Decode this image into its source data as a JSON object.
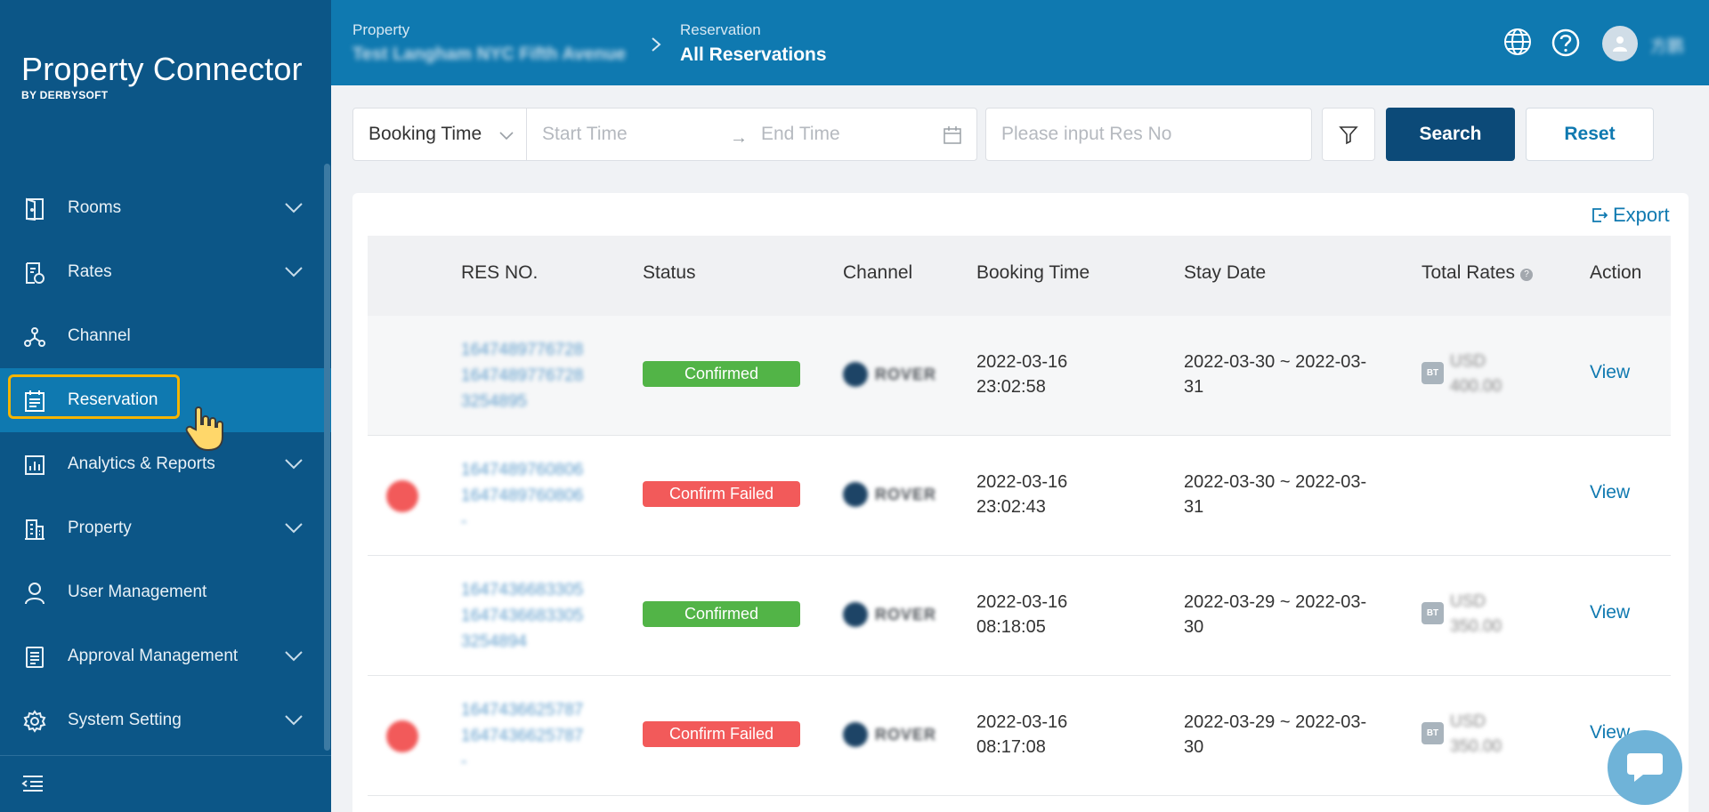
{
  "brand": {
    "title": "Property Connector",
    "subtitle": "BY DERBYSOFT"
  },
  "sidebar": {
    "items": [
      {
        "label": "Rooms",
        "icon": "door-icon",
        "expandable": true
      },
      {
        "label": "Rates",
        "icon": "rates-doc-icon",
        "expandable": true
      },
      {
        "label": "Channel",
        "icon": "channel-network-icon",
        "expandable": false
      },
      {
        "label": "Reservation",
        "icon": "calendar-list-icon",
        "expandable": false,
        "active": true
      },
      {
        "label": "Analytics & Reports",
        "icon": "bar-chart-icon",
        "expandable": true
      },
      {
        "label": "Property",
        "icon": "building-icon",
        "expandable": true
      },
      {
        "label": "User Management",
        "icon": "user-icon",
        "expandable": false
      },
      {
        "label": "Approval Management",
        "icon": "document-icon",
        "expandable": true
      },
      {
        "label": "System Setting",
        "icon": "gear-icon",
        "expandable": true
      }
    ]
  },
  "header": {
    "property_label": "Property",
    "property_value": "Test Langham NYC Fifth Avenue",
    "section_label": "Reservation",
    "section_value": "All Reservations",
    "username": "方鹏"
  },
  "filters": {
    "time_type": "Booking Time",
    "start_placeholder": "Start Time",
    "end_placeholder": "End Time",
    "resno_placeholder": "Please input Res No",
    "search_label": "Search",
    "reset_label": "Reset"
  },
  "table": {
    "export_label": "Export",
    "columns": [
      "RES NO.",
      "Status",
      "Channel",
      "Booking Time",
      "Stay Date",
      "Total Rates",
      "Action"
    ],
    "rows": [
      {
        "resno": [
          "1647489776728",
          "1647489776728",
          "3254895"
        ],
        "status": "Confirmed",
        "status_type": "ok",
        "channel": "ROVER",
        "booking_date": "2022-03-16",
        "booking_time": "23:02:58",
        "stay_line1": "2022-03-30 ~ 2022-03-",
        "stay_line2": "31",
        "rate_badge": "BT",
        "currency": "USD",
        "amount": "400.00",
        "action": "View",
        "alert": false
      },
      {
        "resno": [
          "1647489760806",
          "1647489760806",
          "-"
        ],
        "status": "Confirm Failed",
        "status_type": "fail",
        "channel": "ROVER",
        "booking_date": "2022-03-16",
        "booking_time": "23:02:43",
        "stay_line1": "2022-03-30 ~ 2022-03-",
        "stay_line2": "31",
        "rate_badge": "",
        "currency": "",
        "amount": "",
        "action": "View",
        "alert": true
      },
      {
        "resno": [
          "1647436683305",
          "1647436683305",
          "3254894"
        ],
        "status": "Confirmed",
        "status_type": "ok",
        "channel": "ROVER",
        "booking_date": "2022-03-16",
        "booking_time": "08:18:05",
        "stay_line1": "2022-03-29 ~ 2022-03-",
        "stay_line2": "30",
        "rate_badge": "BT",
        "currency": "USD",
        "amount": "350.00",
        "action": "View",
        "alert": false
      },
      {
        "resno": [
          "1647436625787",
          "1647436625787",
          "-"
        ],
        "status": "Confirm Failed",
        "status_type": "fail",
        "channel": "ROVER",
        "booking_date": "2022-03-16",
        "booking_time": "08:17:08",
        "stay_line1": "2022-03-29 ~ 2022-03-",
        "stay_line2": "30",
        "rate_badge": "BT",
        "currency": "USD",
        "amount": "350.00",
        "action": "View",
        "alert": true
      }
    ]
  },
  "colors": {
    "sidebar": "#0c5687",
    "header": "#0f79b0",
    "active": "#0f79b0",
    "highlight": "#f5b400",
    "ok": "#52b447",
    "fail": "#f25a5a",
    "primary_button": "#0c4a78"
  }
}
